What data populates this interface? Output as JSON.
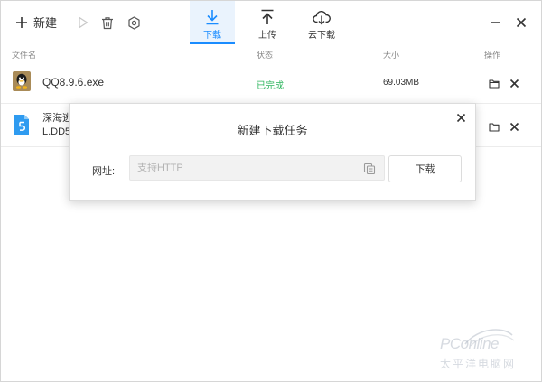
{
  "toolbar": {
    "new_label": "新建",
    "tabs": [
      {
        "label": "下载",
        "icon": "download-icon",
        "active": true
      },
      {
        "label": "上传",
        "icon": "upload-icon",
        "active": false
      },
      {
        "label": "云下载",
        "icon": "cloud-download-icon",
        "active": false
      }
    ],
    "icons": [
      "plus-icon",
      "play-icon",
      "trash-icon",
      "settings-icon",
      "minimize-icon",
      "close-icon"
    ]
  },
  "table": {
    "headers": {
      "name": "文件名",
      "status": "状态",
      "size": "大小",
      "action": "操作"
    },
    "rows": [
      {
        "name": "QQ8.9.6.exe",
        "status": "已完成",
        "size": "69.03MB",
        "icon": "qq-file-icon"
      },
      {
        "name_line1": "深海逃",
        "name_line2": "L.DD5",
        "icon": "doc-file-icon"
      }
    ]
  },
  "dialog": {
    "title": "新建下载任务",
    "url_label": "网址:",
    "url_placeholder": "支持HTTP",
    "url_value": "",
    "submit_label": "下载"
  },
  "watermark": {
    "brand": "PConline",
    "sub": "太平洋电脑网"
  },
  "colors": {
    "accent": "#1a8cff",
    "status_done": "#2db55d",
    "tab_active_bg": "#eaf3fd"
  }
}
